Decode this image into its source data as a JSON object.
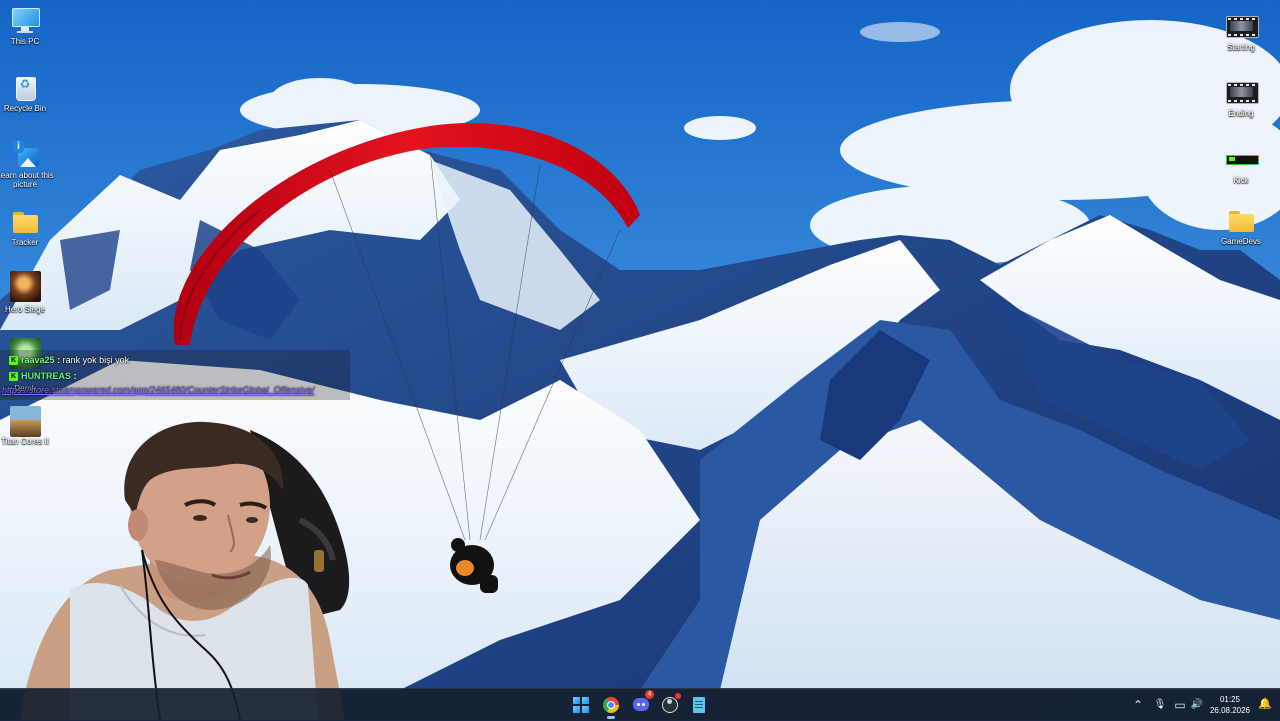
{
  "desktop": {
    "left_icons": [
      {
        "label": "This PC",
        "icon": "monitor-icon"
      },
      {
        "label": "Recycle Bin",
        "icon": "recycle-bin-icon"
      },
      {
        "label": "Learn about this picture",
        "icon": "learn-about-picture-icon"
      },
      {
        "label": "Tracker",
        "icon": "folder-icon"
      },
      {
        "label": "Hero Siege",
        "icon": "game-icon"
      },
      {
        "label": "Dernk",
        "icon": "game-icon"
      },
      {
        "label": "Titan Cores II",
        "icon": "game-icon"
      }
    ],
    "right_icons": [
      {
        "label": "Starting",
        "icon": "video-file-icon"
      },
      {
        "label": "Ending",
        "icon": "video-file-icon"
      },
      {
        "label": "Kick",
        "icon": "kick-shortcut-icon"
      },
      {
        "label": "GameDevs",
        "icon": "folder-icon"
      }
    ]
  },
  "chat": {
    "messages": [
      {
        "user": "raava25",
        "separator": ":",
        "text": "rank yok bişi yok"
      },
      {
        "user": "HUNTREAS",
        "separator": ":",
        "text": ""
      }
    ],
    "link": "https://store.steampowered.com/app/2465480/CounterStrikeGlobal_Offensive/",
    "badge_icon": "kick-badge-icon",
    "colors": {
      "user": "#7df98a",
      "link": "#8a74ff",
      "badge": "#53fc18"
    }
  },
  "taskbar": {
    "apps": [
      {
        "name": "start",
        "icon": "windows-logo-icon"
      },
      {
        "name": "chrome",
        "icon": "chrome-icon"
      },
      {
        "name": "discord",
        "icon": "discord-icon",
        "badge": "4"
      },
      {
        "name": "obs",
        "icon": "obs-icon"
      },
      {
        "name": "notepad",
        "icon": "notepad-icon"
      }
    ],
    "tray": {
      "chevron": "⌃",
      "microphone": "🎙",
      "network": "▭",
      "volume": "🔊"
    },
    "clock": {
      "time": "01:25",
      "date": "26.08.2026"
    }
  }
}
